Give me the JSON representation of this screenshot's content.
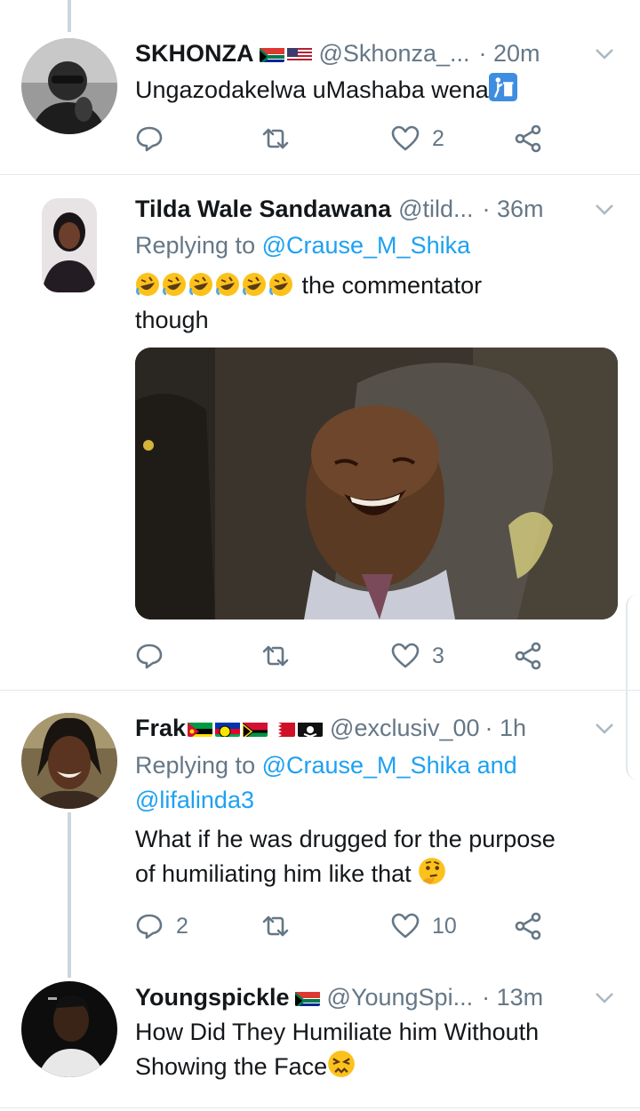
{
  "tweets": [
    {
      "name": "SKHONZA",
      "flags": [
        "za",
        "us"
      ],
      "handle": "@Skhonza_...",
      "time": "· 20m",
      "text": "Ungazodakelwa uMashaba wena",
      "trailing_emoji": "litter-bin-icon",
      "reply_count": "",
      "retweet_count": "",
      "like_count": "2"
    },
    {
      "name": "Tilda Wale Sandawana",
      "handle": "@tild...",
      "time": "· 36m",
      "replying_prefix": "Replying to ",
      "replying_to": "@Crause_M_Shika",
      "text": "the commentator though",
      "leading_emojis": [
        "rofl-emoji",
        "rofl-emoji",
        "rofl-emoji",
        "rofl-emoji",
        "rofl-emoji",
        "rofl-emoji"
      ],
      "text_line1": "the commentator",
      "text_line2": "though",
      "reply_count": "",
      "retweet_count": "",
      "like_count": "3"
    },
    {
      "name": "Frak",
      "flags": [
        "mz",
        "nc",
        "vu",
        "bh",
        "pirate"
      ],
      "handle": "@exclusiv_00",
      "time": "· 1h",
      "replying_prefix": "Replying to ",
      "replying_to": "@Crause_M_Shika",
      "replying_and": " and",
      "replying_to2": "@lifalinda3",
      "text_line1": "What if he was drugged for the purpose",
      "text_line2": "of humiliating him like that",
      "trailing_emoji": "thinking-face-emoji",
      "reply_count": "2",
      "retweet_count": "",
      "like_count": "10"
    },
    {
      "name": "Youngspickle",
      "flags": [
        "za"
      ],
      "handle": "@YoungSpi...",
      "time": "· 13m",
      "text_line1": "How Did They Humiliate him Withouth",
      "text_line2": "Showing the Face",
      "trailing_emoji": "persevering-face-emoji"
    }
  ],
  "colors": {
    "link": "#1da1f2",
    "secondary": "#657786",
    "divider": "#e1e8ed",
    "thread": "#ccd6dd"
  }
}
